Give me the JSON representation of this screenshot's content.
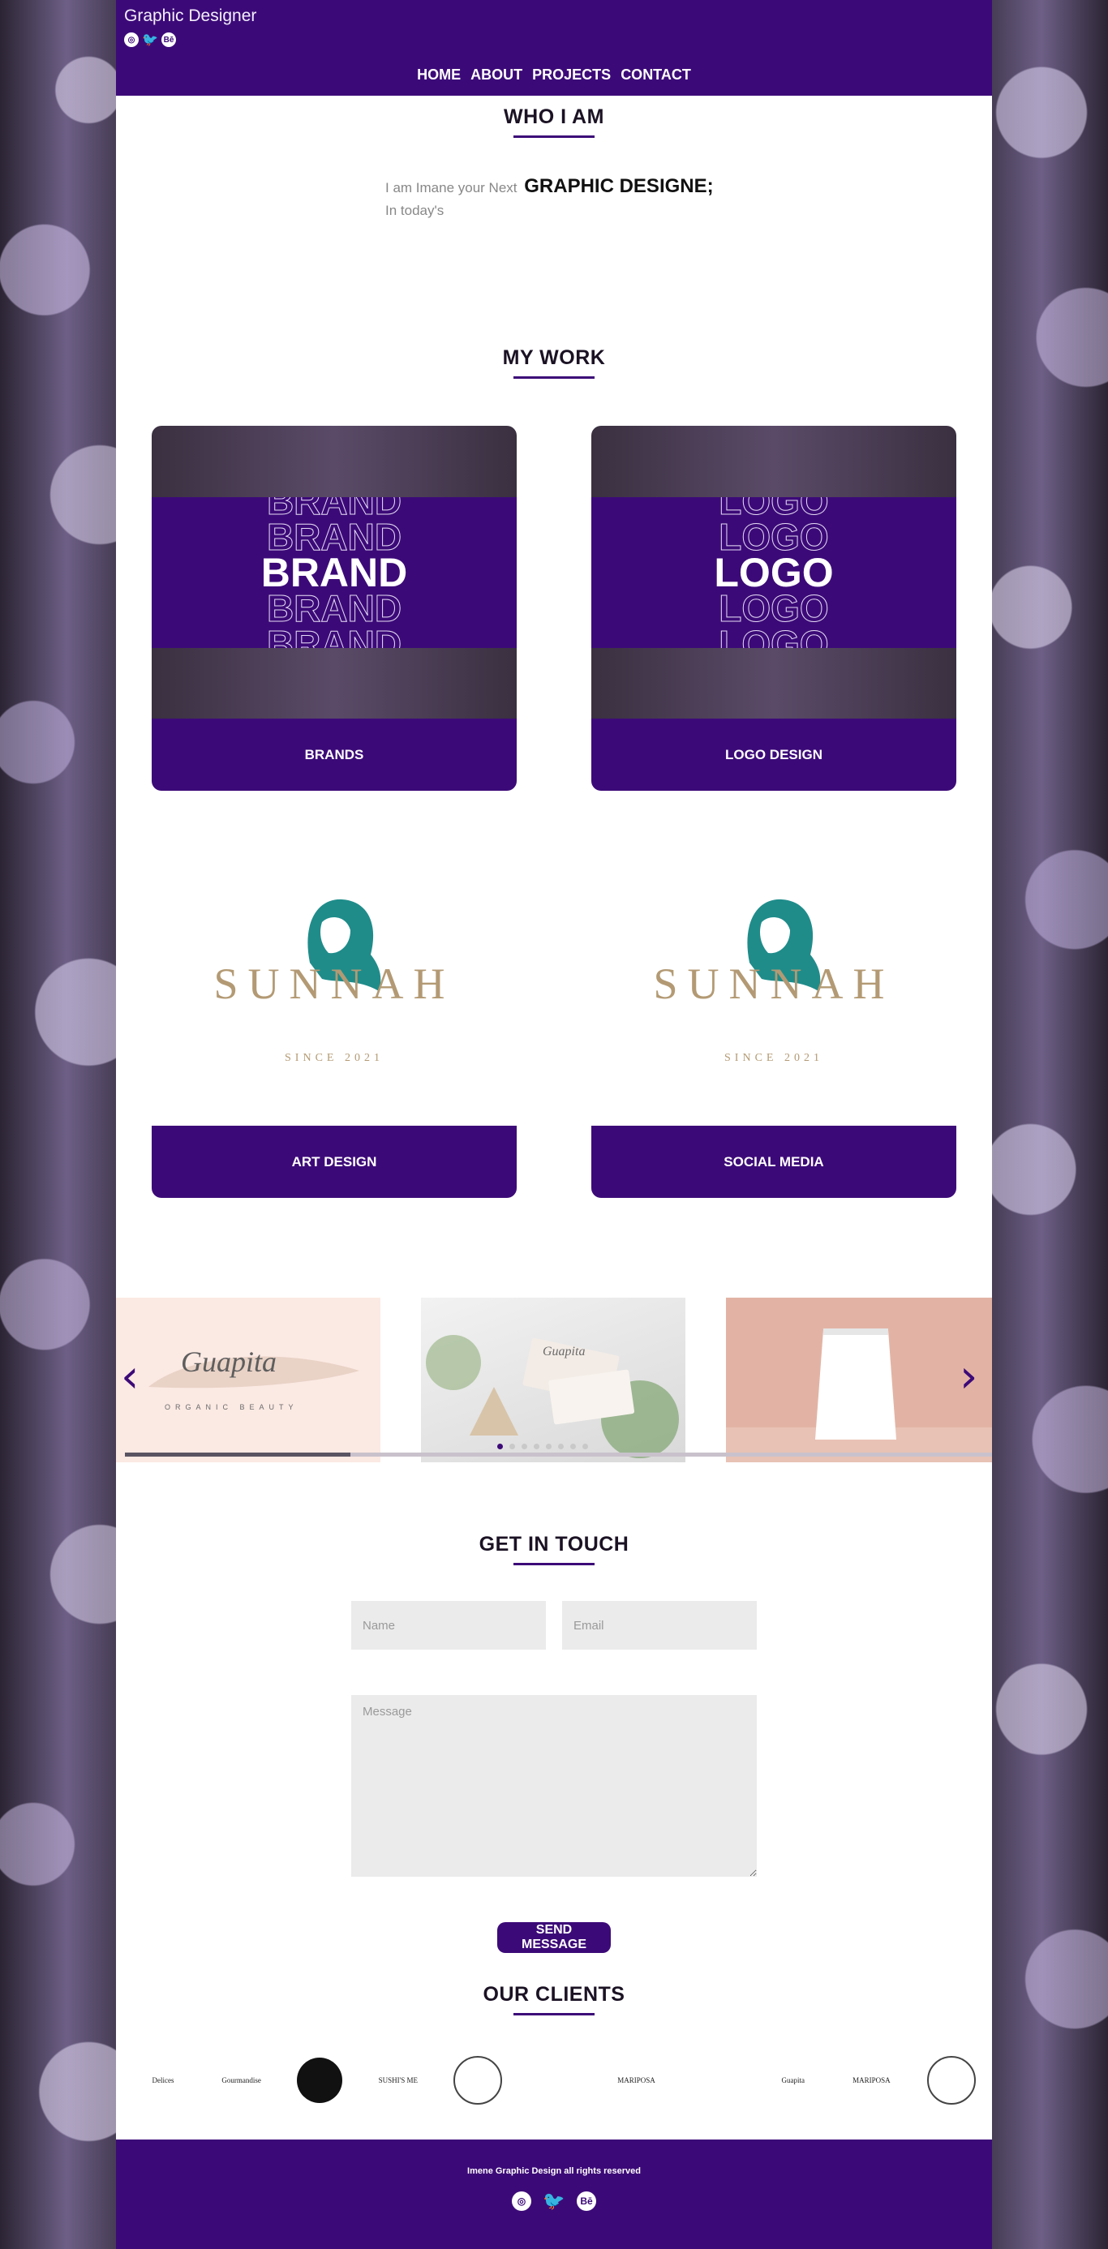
{
  "header": {
    "site_title": "Graphic Designer",
    "social": [
      {
        "icon": "instagram-icon",
        "glyph": "◎"
      },
      {
        "icon": "twitter-icon",
        "glyph": "🐦"
      },
      {
        "icon": "behance-icon",
        "glyph": "Bē"
      }
    ],
    "nav": [
      "HOME",
      "ABOUT",
      "PROJECTS",
      "CONTACT"
    ]
  },
  "who": {
    "title": "WHO I AM",
    "intro": "I am Imane your Next",
    "headline": "GRAPHIC DESIGNE;",
    "line2": "In today's"
  },
  "work": {
    "title": "MY WORK",
    "cards": [
      {
        "label": "BRANDS",
        "art_word": "BRAND"
      },
      {
        "label": "LOGO DESIGN",
        "art_word": "LOGO"
      },
      {
        "label": "ART DESIGN",
        "art_word": "SUNNAH"
      },
      {
        "label": "SOCIAL MEDIA",
        "art_word": "SUNNAH"
      }
    ],
    "sunnah_since": "SINCE 2021",
    "sunnah_script": "Hs"
  },
  "carousel": {
    "slides": [
      {
        "title": "Guapita",
        "subtitle": "ORGANIC BEAUTY"
      },
      {
        "title": "Guapita",
        "subtitle": ""
      },
      {
        "title": "",
        "subtitle": ""
      }
    ],
    "prev_glyph": "‹",
    "next_glyph": "›",
    "dot_count": 8,
    "active_dot": 0,
    "progress": 0.26
  },
  "contact": {
    "title": "GET IN TOUCH",
    "name_placeholder": "Name",
    "email_placeholder": "Email",
    "message_placeholder": "Message",
    "send_label": "SEND MESSAGE"
  },
  "clients": {
    "title": "OUR CLIENTS",
    "logos": [
      "Delices",
      "Gourmandise",
      "",
      "SUSHI'S ME",
      "",
      "",
      "MARIPOSA",
      "",
      "Guapita",
      "MARIPOSA",
      ""
    ]
  },
  "footer": {
    "copyright": "Imene Graphic Design all rights reserved"
  },
  "colors": {
    "brand_purple": "#3c0a78",
    "card_purple": "#3c0a78"
  }
}
